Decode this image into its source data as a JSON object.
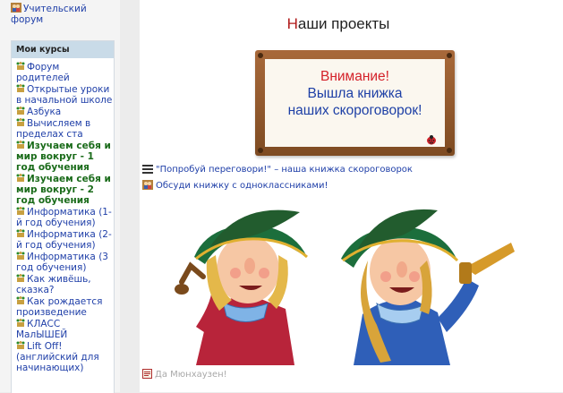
{
  "sidebar": {
    "top_forum": "Учительский форум",
    "block_title": "Мои курсы",
    "courses": [
      {
        "label": "Форум родителей",
        "bold": false
      },
      {
        "label": "Открытые уроки в начальной школе",
        "bold": false
      },
      {
        "label": "Азбука",
        "bold": false
      },
      {
        "label": "Вычисляем в пределах ста",
        "bold": false
      },
      {
        "label": "Изучаем себя и мир вокруг - 1 год обучения",
        "bold": true
      },
      {
        "label": "Изучаем себя и мир вокруг - 2 год обучения",
        "bold": true
      },
      {
        "label": "Информатика (1-й год обучения)",
        "bold": false
      },
      {
        "label": "Информатика (2-й год обучения)",
        "bold": false
      },
      {
        "label": "Информатика (3 год обучения)",
        "bold": false
      },
      {
        "label": "Как живёшь, сказка?",
        "bold": false
      },
      {
        "label": "Как рождается произведение",
        "bold": false
      },
      {
        "label": "КЛАСС МалЫШЕЙ",
        "bold": false
      },
      {
        "label": "Lift Off!(английский для начинающих)",
        "bold": false
      }
    ]
  },
  "main": {
    "title_first": "Н",
    "title_rest": "аши проекты",
    "notice": {
      "line1": "Внимание!",
      "line2": "Вышла книжка",
      "line3": "наших скороговорок!"
    },
    "resources": [
      {
        "label": "\"Попробуй переговори!\" – наша книжка скороговорок",
        "icon": "book-icon"
      },
      {
        "label": "Обсуди книжку с одноклассниками!",
        "icon": "forum-icon"
      }
    ],
    "caption": "Да Мюнхаузен!",
    "colors": {
      "link": "#1f3fa8",
      "bold_link": "#1a6b1a",
      "title_accent": "#b01a1a",
      "notice_red": "#d4222a",
      "notice_blue": "#1e40a6",
      "block_header_bg": "#c9dbe8"
    }
  }
}
